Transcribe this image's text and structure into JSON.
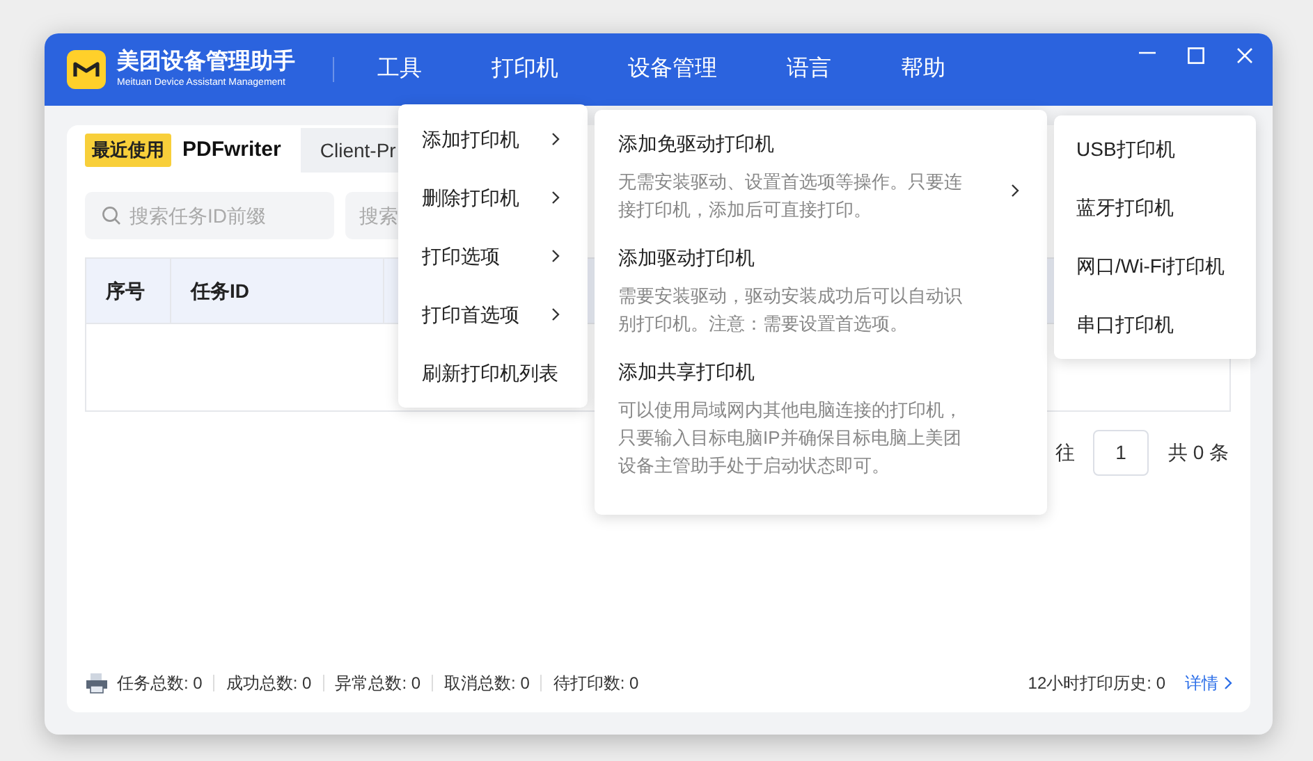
{
  "app": {
    "title": "美团设备管理助手",
    "subtitle": "Meituan Device Assistant Management"
  },
  "menu_bar": [
    "工具",
    "打印机",
    "设备管理",
    "语言",
    "帮助"
  ],
  "tabs": [
    {
      "label": "PDFwriter",
      "badge": "最近使用",
      "selected": true
    },
    {
      "label": "Client-Pr",
      "selected": false
    }
  ],
  "search_fields": [
    {
      "placeholder": "搜索任务ID前缀"
    },
    {
      "placeholder": "搜索"
    }
  ],
  "table": {
    "columns": [
      "序号",
      "任务ID"
    ]
  },
  "pagination": {
    "goto_label": "往",
    "page": "1",
    "total": "共 0 条"
  },
  "status_bar": {
    "stats": [
      "任务总数: 0",
      "成功总数: 0",
      "异常总数: 0",
      "取消总数: 0",
      "待打印数: 0"
    ],
    "history": "12小时打印历史: 0",
    "details_link": "详情"
  },
  "printer_menu": [
    {
      "label": "添加打印机",
      "has_submenu": true
    },
    {
      "label": "删除打印机",
      "has_submenu": true
    },
    {
      "label": "打印选项",
      "has_submenu": true
    },
    {
      "label": "打印首选项",
      "has_submenu": true
    },
    {
      "label": "刷新打印机列表",
      "has_submenu": false
    }
  ],
  "add_printer_menu": [
    {
      "title": "添加免驱动打印机",
      "description": "无需安装驱动、设置首选项等操作。只要连接打印机，添加后可直接打印。",
      "has_submenu": true
    },
    {
      "title": "添加驱动打印机",
      "description": "需要安装驱动，驱动安装成功后可以自动识别打印机。注意：需要设置首选项。",
      "has_submenu": false
    },
    {
      "title": "添加共享打印机",
      "description": "可以使用局域网内其他电脑连接的打印机，只要输入目标电脑IP并确保目标电脑上美团设备主管助手处于启动状态即可。",
      "has_submenu": false
    }
  ],
  "connection_menu": [
    "USB打印机",
    "蓝牙打印机",
    "网口/Wi-Fi打印机",
    "串口打印机"
  ]
}
